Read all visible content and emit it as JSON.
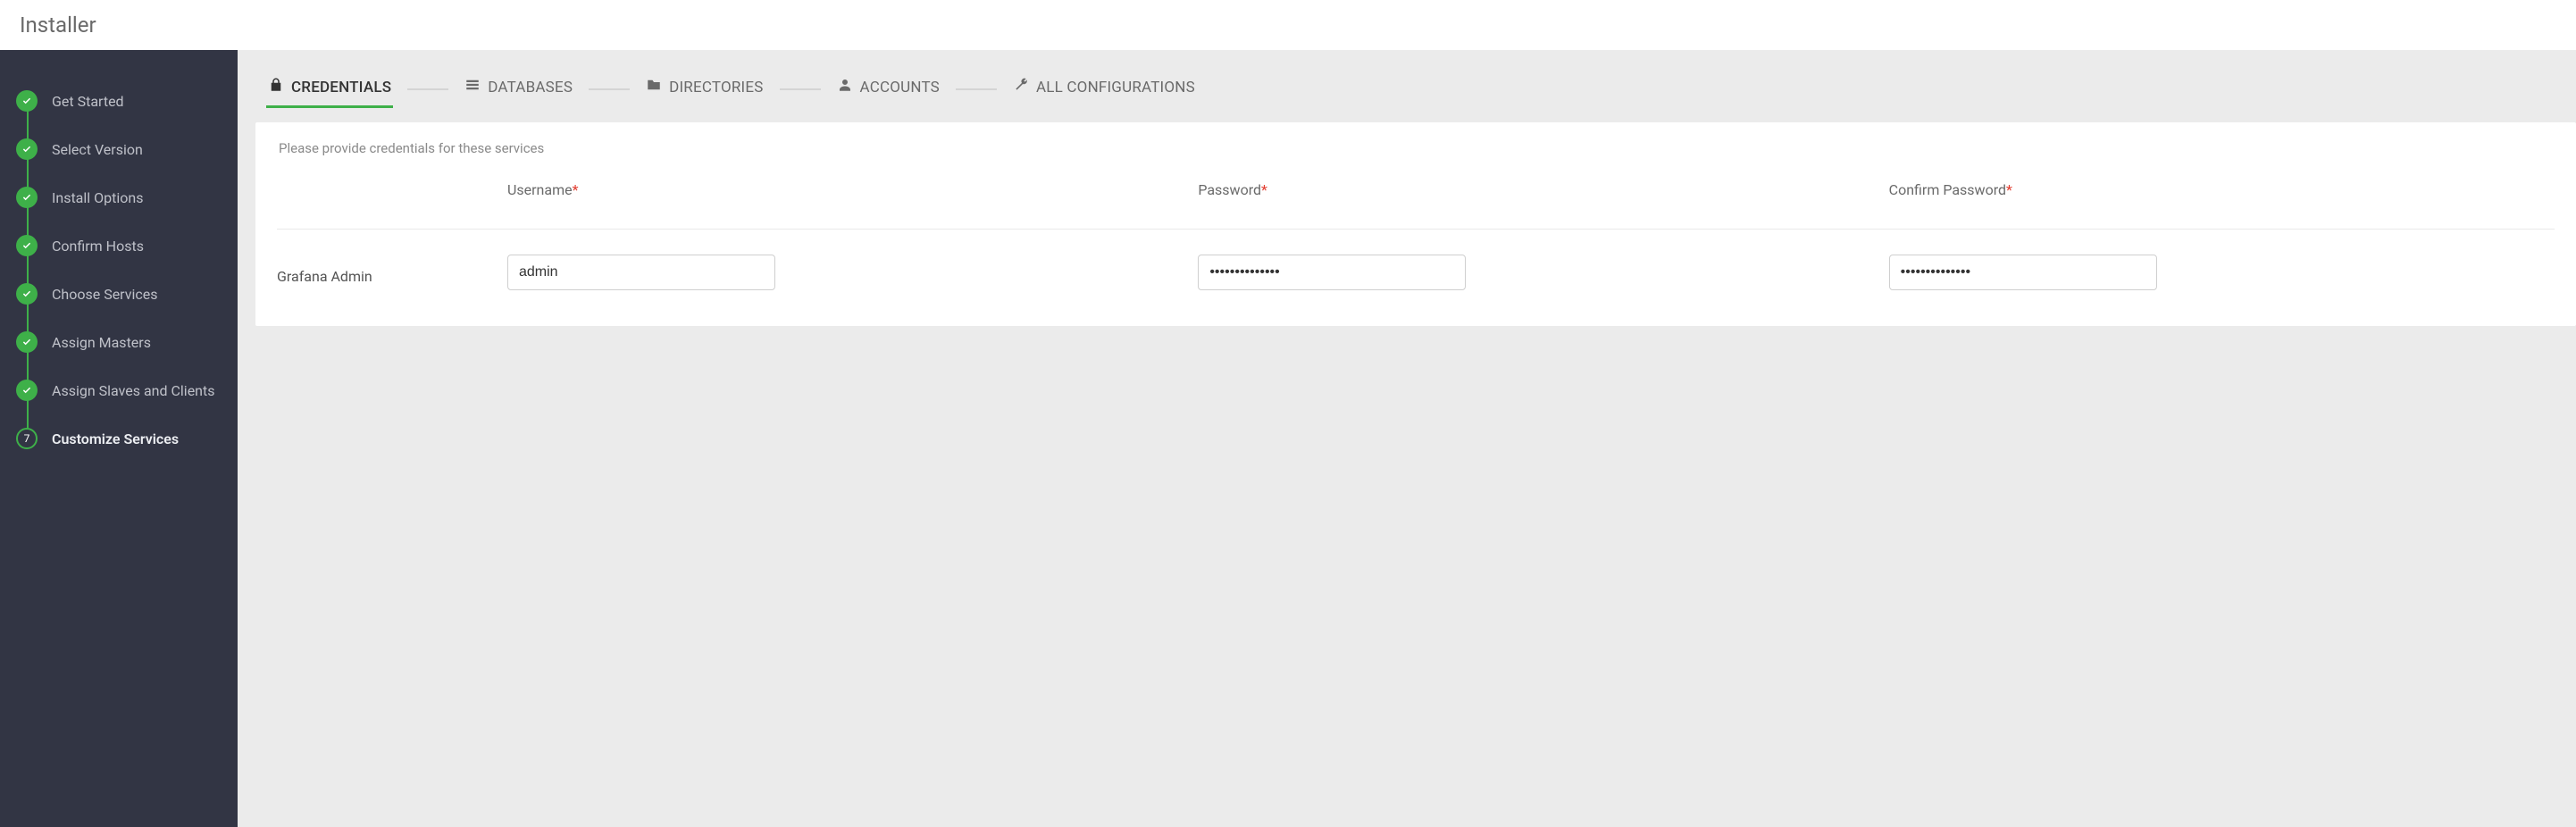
{
  "header": {
    "title": "Installer"
  },
  "sidebar": {
    "steps": [
      {
        "label": "Get Started",
        "done": true,
        "current": false
      },
      {
        "label": "Select Version",
        "done": true,
        "current": false
      },
      {
        "label": "Install Options",
        "done": true,
        "current": false
      },
      {
        "label": "Confirm Hosts",
        "done": true,
        "current": false
      },
      {
        "label": "Choose Services",
        "done": true,
        "current": false
      },
      {
        "label": "Assign Masters",
        "done": true,
        "current": false
      },
      {
        "label": "Assign Slaves and Clients",
        "done": true,
        "current": false
      },
      {
        "label": "Customize Services",
        "done": false,
        "current": true,
        "number": "7"
      }
    ]
  },
  "tabs": {
    "items": [
      {
        "label": "CREDENTIALS",
        "icon": "lock-icon",
        "active": true
      },
      {
        "label": "DATABASES",
        "icon": "list-icon",
        "active": false
      },
      {
        "label": "DIRECTORIES",
        "icon": "folder-icon",
        "active": false
      },
      {
        "label": "ACCOUNTS",
        "icon": "user-icon",
        "active": false
      },
      {
        "label": "ALL CONFIGURATIONS",
        "icon": "wrench-icon",
        "active": false
      }
    ]
  },
  "credentials": {
    "instruction": "Please provide credentials for these services",
    "columns": {
      "username": "Username",
      "password": "Password",
      "confirm": "Confirm Password"
    },
    "rows": [
      {
        "service": "Grafana Admin",
        "username": "admin",
        "password": "••••••••••••••",
        "confirm": "••••••••••••••"
      }
    ]
  }
}
